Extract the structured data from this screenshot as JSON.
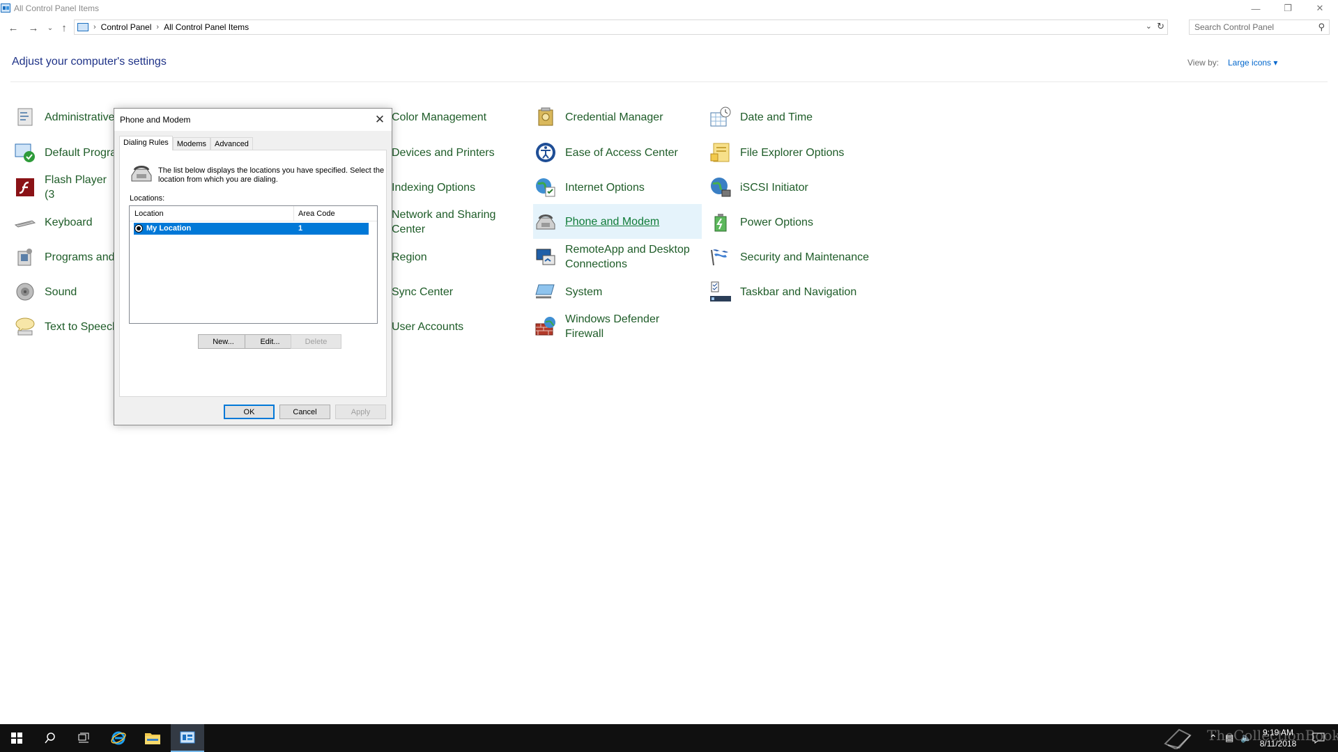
{
  "window": {
    "title": "All Control Panel Items"
  },
  "address": {
    "crumbs": [
      "Control Panel",
      "All Control Panel Items"
    ],
    "search_placeholder": "Search Control Panel"
  },
  "header": {
    "heading": "Adjust your computer's settings",
    "view_by_label": "View by:",
    "view_by_value": "Large icons"
  },
  "items": {
    "col1": [
      "Administrative",
      "Default Progra",
      "Flash Player (3",
      "Keyboard",
      "Programs and",
      "Sound",
      "Text to Speech"
    ],
    "col2": [
      "Color Management",
      "Devices and Printers",
      "Indexing Options",
      "Network and Sharing Center",
      "Region",
      "Sync Center",
      "User Accounts"
    ],
    "col3": [
      "Credential Manager",
      "Ease of Access Center",
      "Internet Options",
      "Phone and Modem",
      "RemoteApp and Desktop Connections",
      "System",
      "Windows Defender Firewall"
    ],
    "col4": [
      "Date and Time",
      "File Explorer Options",
      "iSCSI Initiator",
      "Power Options",
      "Security and Maintenance",
      "Taskbar and Navigation"
    ]
  },
  "dialog": {
    "title": "Phone and Modem",
    "tabs": [
      "Dialing Rules",
      "Modems",
      "Advanced"
    ],
    "description": "The list below displays the locations you have specified. Select the location from which you are dialing.",
    "locations_label": "Locations:",
    "columns": [
      "Location",
      "Area Code"
    ],
    "rows": [
      {
        "location": "My Location",
        "area_code": "1"
      }
    ],
    "buttons": {
      "new": "New...",
      "edit": "Edit...",
      "delete": "Delete",
      "ok": "OK",
      "cancel": "Cancel",
      "apply": "Apply"
    }
  },
  "taskbar": {
    "time": "9:19 AM",
    "date": "8/11/2018",
    "watermark": "TheCollectionBook"
  },
  "colors": {
    "link_green": "#1e5c28",
    "heading_blue": "#1e3287",
    "selection": "#0078d7",
    "taskbar": "#101010"
  }
}
